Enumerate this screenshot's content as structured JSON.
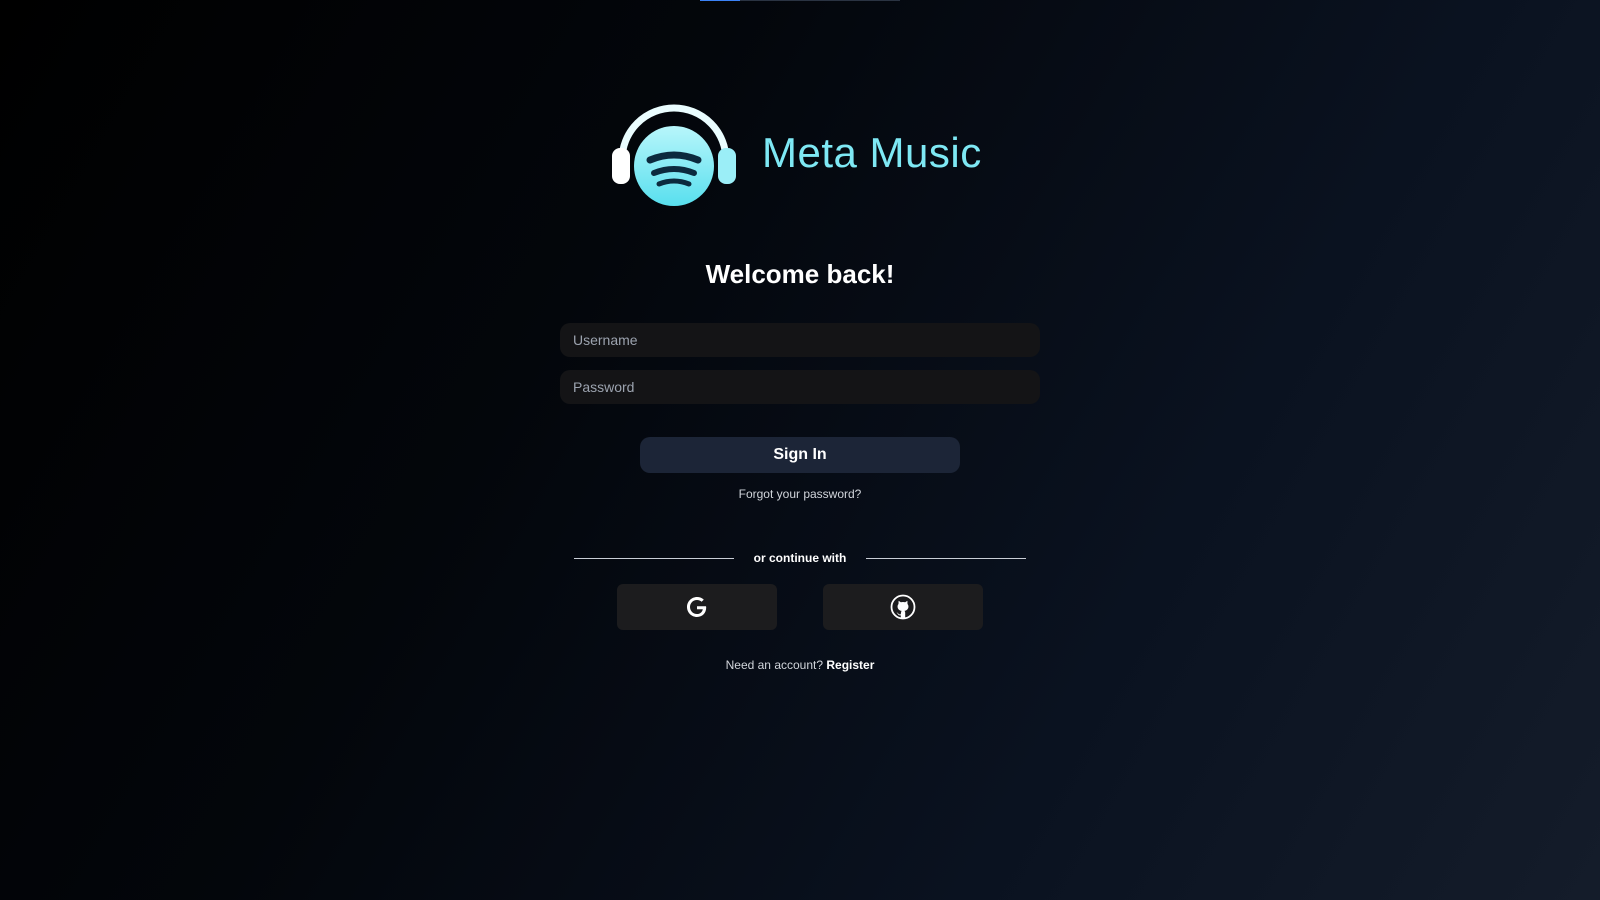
{
  "brand": {
    "name": "Meta Music",
    "accent_color": "#7ee8f4",
    "logo_icon": "headphones-logo-icon"
  },
  "login": {
    "heading": "Welcome back!",
    "username_placeholder": "Username",
    "username_value": "",
    "password_placeholder": "Password",
    "password_value": "",
    "sign_in_label": "Sign In",
    "forgot_password": "Forgot your password?",
    "divider_text": "or continue with",
    "social": [
      {
        "provider": "Google",
        "icon": "google-icon"
      },
      {
        "provider": "GitHub",
        "icon": "github-icon"
      }
    ],
    "register_prompt": "Need an account?",
    "register_link": "Register"
  },
  "colors": {
    "button_bg": "#1c2537",
    "input_bg": "#141416",
    "social_bg": "#1c1c1e",
    "progress": "#3b82f6"
  }
}
